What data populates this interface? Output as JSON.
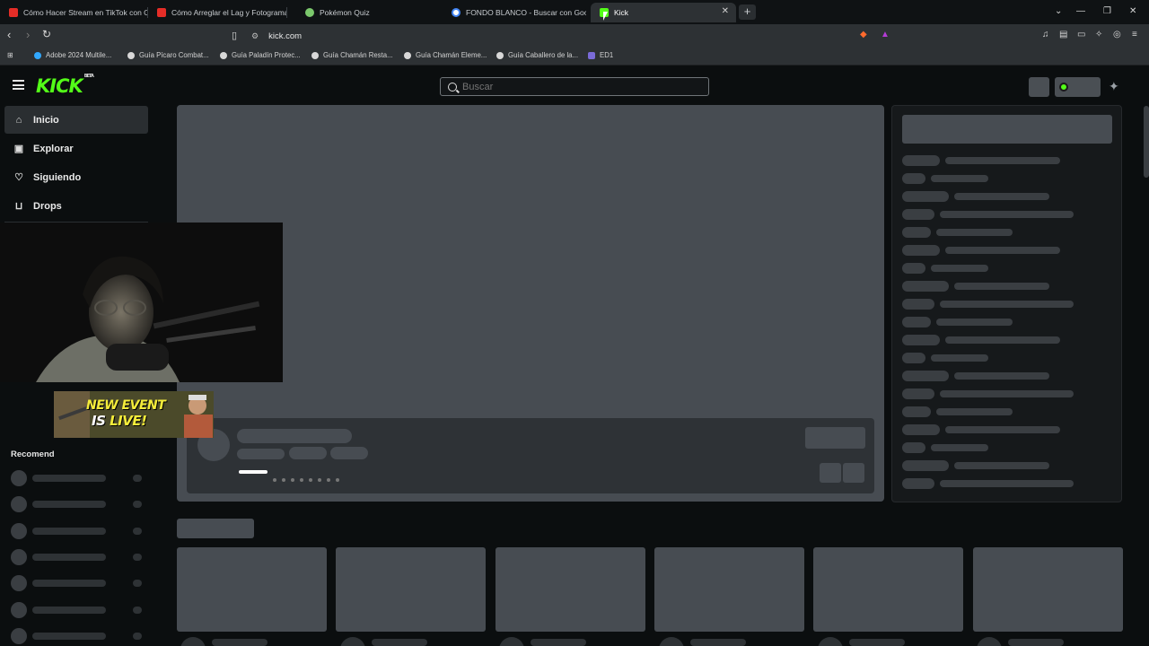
{
  "tabs": [
    {
      "title": "Cómo Hacer Stream en TikTok con OBS",
      "favicon_color": "#e52d27"
    },
    {
      "title": "Cómo Arreglar el Lag y Fotogramas Perdidos",
      "favicon_color": "#e52d27"
    },
    {
      "title": "Pokémon Quiz",
      "favicon_color": "#7bc86c"
    },
    {
      "title": "FONDO BLANCO - Buscar con Google",
      "favicon_color": "#4285f4"
    },
    {
      "title": "Kick",
      "favicon_color": "#53fc18",
      "close": "✕"
    }
  ],
  "newtab_label": "+",
  "window_controls": {
    "dropdown": "⌄",
    "minimize": "—",
    "restore": "❐",
    "close": "✕"
  },
  "address": {
    "url": "kick.com"
  },
  "bookmarks": [
    {
      "label": "Adobe 2024 Multile..."
    },
    {
      "label": "Guía Pícaro Combat..."
    },
    {
      "label": "Guía Paladín Protec..."
    },
    {
      "label": "Guía Chamán Resta..."
    },
    {
      "label": "Guía Chamán Eleme..."
    },
    {
      "label": "Guía Caballero de la..."
    },
    {
      "label": "ED1"
    }
  ],
  "kick": {
    "logo": "KICK",
    "logo_badge": "BETA",
    "brand_color": "#53fc18",
    "search_placeholder": "Buscar",
    "sidebar": [
      {
        "label": "Inicio",
        "icon": "home-icon",
        "glyph": "⌂"
      },
      {
        "label": "Explorar",
        "icon": "explore-icon",
        "glyph": "▣"
      },
      {
        "label": "Siguiendo",
        "icon": "heart-icon",
        "glyph": "♡"
      },
      {
        "label": "Drops",
        "icon": "drops-icon",
        "glyph": "⊔"
      }
    ],
    "recommended_label": "Recomend",
    "event_banner": {
      "line1": "NEW EVENT",
      "line2a": "IS ",
      "line2b": "LIVE!"
    }
  }
}
